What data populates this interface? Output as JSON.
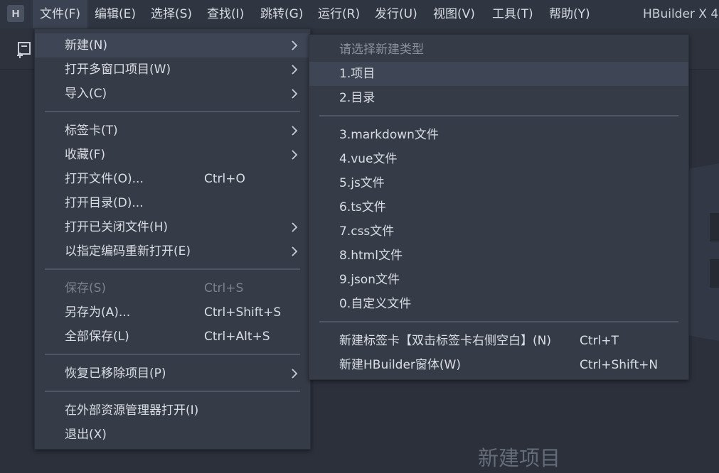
{
  "app": {
    "logo_letter": "H",
    "title": "HBuilder X 4"
  },
  "menubar": [
    {
      "label": "文件(F)",
      "active": true
    },
    {
      "label": "编辑(E)"
    },
    {
      "label": "选择(S)"
    },
    {
      "label": "查找(I)"
    },
    {
      "label": "跳转(G)"
    },
    {
      "label": "运行(R)"
    },
    {
      "label": "发行(U)"
    },
    {
      "label": "视图(V)"
    },
    {
      "label": "工具(T)"
    },
    {
      "label": "帮助(Y)"
    }
  ],
  "background": {
    "label": "新建项目"
  },
  "file_menu": {
    "items": [
      {
        "label": "新建(N)",
        "shortcut": "",
        "submenu": true,
        "highlighted": true
      },
      {
        "label": "打开多窗口项目(W)",
        "shortcut": "",
        "submenu": true
      },
      {
        "label": "导入(C)",
        "shortcut": "",
        "submenu": true
      },
      {
        "label": "标签卡(T)",
        "shortcut": "",
        "submenu": true
      },
      {
        "label": "收藏(F)",
        "shortcut": "",
        "submenu": true
      },
      {
        "label": "打开文件(O)...",
        "shortcut": "Ctrl+O"
      },
      {
        "label": "打开目录(D)...",
        "shortcut": ""
      },
      {
        "label": "打开已关闭文件(H)",
        "shortcut": "",
        "submenu": true
      },
      {
        "label": "以指定编码重新打开(E)",
        "shortcut": "",
        "submenu": true
      },
      {
        "label": "保存(S)",
        "shortcut": "Ctrl+S",
        "disabled": true
      },
      {
        "label": "另存为(A)...",
        "shortcut": "Ctrl+Shift+S"
      },
      {
        "label": "全部保存(L)",
        "shortcut": "Ctrl+Alt+S"
      },
      {
        "label": "恢复已移除项目(P)",
        "shortcut": "",
        "submenu": true
      },
      {
        "label": "在外部资源管理器打开(I)",
        "shortcut": ""
      },
      {
        "label": "退出(X)",
        "shortcut": ""
      }
    ]
  },
  "new_submenu": {
    "header": "请选择新建类型",
    "items": [
      {
        "label": "1.项目",
        "shortcut": "",
        "highlighted": true
      },
      {
        "label": "2.目录",
        "shortcut": ""
      },
      {
        "label": "3.markdown文件",
        "shortcut": ""
      },
      {
        "label": "4.vue文件",
        "shortcut": ""
      },
      {
        "label": "5.js文件",
        "shortcut": ""
      },
      {
        "label": "6.ts文件",
        "shortcut": ""
      },
      {
        "label": "7.css文件",
        "shortcut": ""
      },
      {
        "label": "8.html文件",
        "shortcut": ""
      },
      {
        "label": "9.json文件",
        "shortcut": ""
      },
      {
        "label": "0.自定义文件",
        "shortcut": ""
      },
      {
        "label": "新建标签卡【双击标签卡右侧空白】(N)",
        "shortcut": "Ctrl+T"
      },
      {
        "label": "新建HBuilder窗体(W)",
        "shortcut": "Ctrl+Shift+N"
      }
    ]
  }
}
